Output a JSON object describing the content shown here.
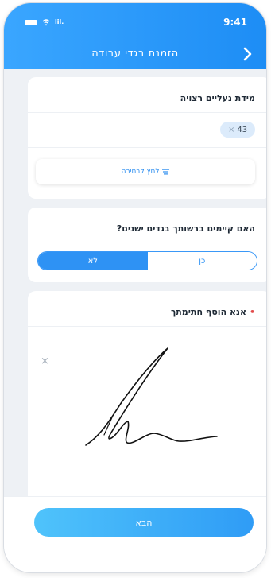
{
  "status_bar": {
    "time": "9:41",
    "signal": "lil."
  },
  "navbar": {
    "title": "הזמנת בגדי עבודה",
    "back_icon": "chevron-right-icon"
  },
  "shoe_size": {
    "title": "מידת נעליים רצויה",
    "selected_chip": "43",
    "chip_remove_icon": "×",
    "select_button_label": "לחץ לבחירה"
  },
  "old_clothes": {
    "question": "האם קיימים ברשותך בגדים ישנים?",
    "options": {
      "yes": "כן",
      "no": "לא"
    },
    "selected": "no"
  },
  "signature": {
    "title": "אנא הוסף חתימתך",
    "required_mark": "•",
    "clear_icon": "×"
  },
  "footer": {
    "next_label": "הבא"
  },
  "colors": {
    "primary": "#2e92f4",
    "header_start": "#3aa6ff",
    "header_end": "#1d8df5",
    "required": "#e24c4c"
  }
}
